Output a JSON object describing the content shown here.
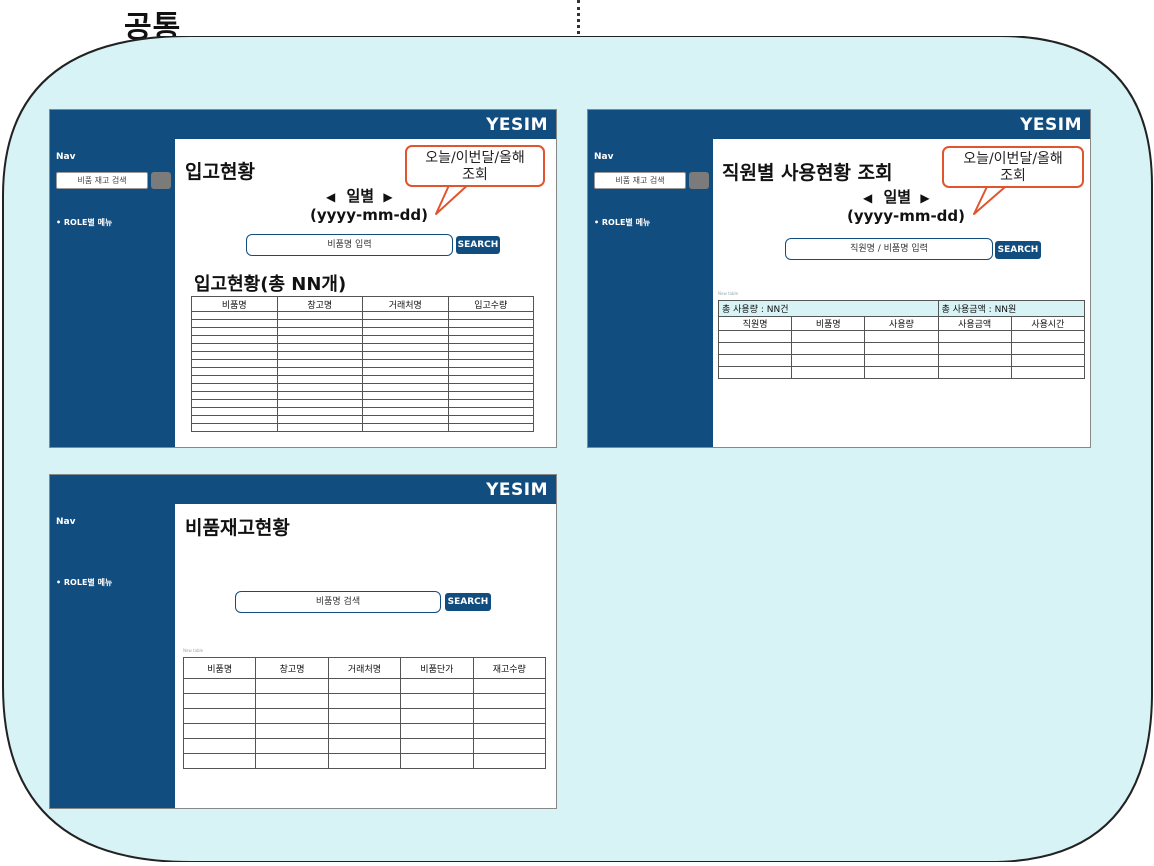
{
  "page": {
    "heading": "공통"
  },
  "brand": {
    "logo": "YESIM",
    "color": "#124d80",
    "accent": "#e0552e",
    "board_bg": "#d8f3f6"
  },
  "nav": {
    "label": "Nav",
    "search_placeholder": "비품 재고 검색",
    "role_menu": "• ROLE별 메뉴"
  },
  "screens": {
    "receipt": {
      "title": "입고현황",
      "prev_arrow": "◀",
      "next_arrow": "▶",
      "period": "일별",
      "date_format": "(yyyy-mm-dd)",
      "callout_line1": "오늘/이번달/올해",
      "callout_line2": "조회",
      "search_placeholder": "비품명 입력",
      "search_button": "SEARCH",
      "table_title": "입고현황(총 NN개)",
      "columns": [
        "비품명",
        "창고명",
        "거래처명",
        "입고수량"
      ]
    },
    "employee_usage": {
      "title": "직원별 사용현황 조회",
      "prev_arrow": "◀",
      "next_arrow": "▶",
      "period": "일별",
      "date_format": "(yyyy-mm-dd)",
      "callout_line1": "오늘/이번달/올해",
      "callout_line2": "조회",
      "search_placeholder": "직원명 / 비품명 입력",
      "search_button": "SEARCH",
      "caption": "New table",
      "summary_total_usage": "총 사용량 : NN건",
      "summary_total_amount": "총 사용금액 : NN원",
      "columns": [
        "직원명",
        "비품명",
        "사용량",
        "사용금액",
        "사용시간"
      ]
    },
    "inventory": {
      "title": "비품재고현황",
      "search_placeholder": "비품명 검색",
      "search_button": "SEARCH",
      "caption": "New table",
      "columns": [
        "비품명",
        "창고명",
        "거래처명",
        "비품단가",
        "재고수량"
      ]
    }
  }
}
